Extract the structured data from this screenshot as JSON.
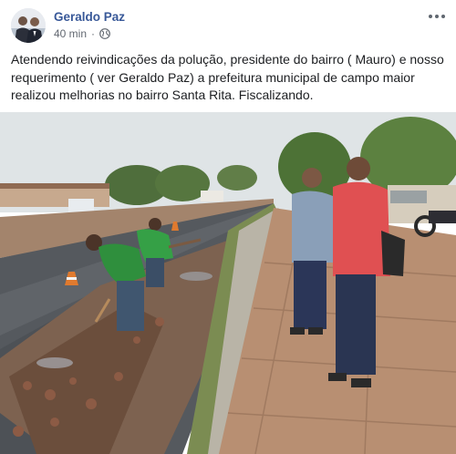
{
  "post": {
    "author": "Geraldo Paz",
    "time": "40 min",
    "separator": "·",
    "privacy_icon": "globe-icon",
    "more_icon": "more-options-icon",
    "text": "Atendendo reivindicações da polução, presidente do bairro ( Mauro) e nosso requerimento ( ver Geraldo Paz) a prefeitura municipal de campo maior realizou melhorias no bairro Santa Rita. Fiscalizando."
  },
  "colors": {
    "author_link": "#385898",
    "meta_text": "#616770",
    "body_text": "#1c1e21"
  }
}
